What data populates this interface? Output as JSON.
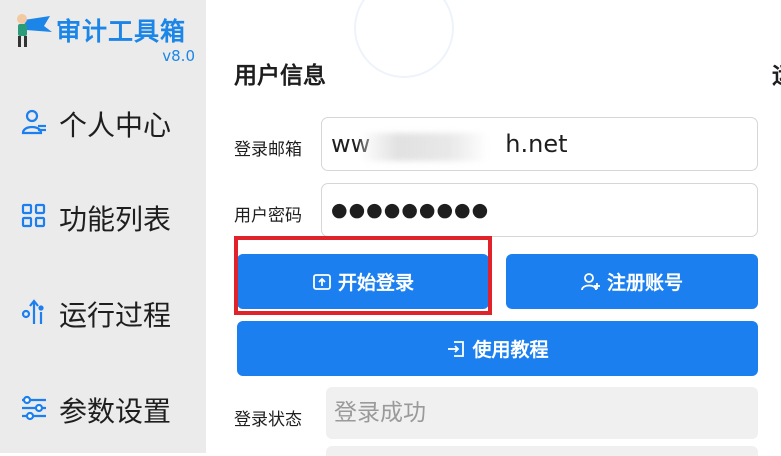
{
  "sidebar": {
    "app_title": "审计工具箱",
    "version": "v8.0",
    "items": [
      {
        "label": "个人中心",
        "icon": "user-icon"
      },
      {
        "label": "功能列表",
        "icon": "grid-icon"
      },
      {
        "label": "运行过程",
        "icon": "process-icon"
      },
      {
        "label": "参数设置",
        "icon": "sliders-icon"
      }
    ]
  },
  "main": {
    "section_title": "用户信息",
    "edge_title_char": "运",
    "email_label": "登录邮箱",
    "email_value_start": "ww",
    "email_value_end": "h.net",
    "password_label": "用户密码",
    "password_value": "●●●●●●●●●",
    "login_button": "开始登录",
    "register_button": "注册账号",
    "tutorial_button": "使用教程",
    "status_label": "登录状态",
    "status_value": "登录成功"
  },
  "colors": {
    "accent": "#1b7ff0",
    "brand_text": "#1b86e8",
    "highlight": "#e0232a",
    "sidebar_bg": "#ebebeb"
  }
}
